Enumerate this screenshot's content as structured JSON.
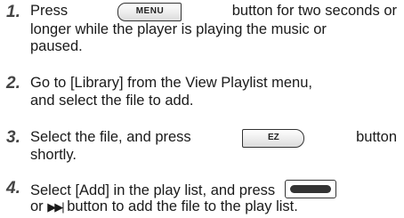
{
  "steps": [
    {
      "number": "1.",
      "line1_before": "Press",
      "button": "MENU",
      "line1_after": "button for two seconds or",
      "line2": "longer while the player is playing the music or",
      "line3": "paused."
    },
    {
      "number": "2.",
      "line1": "Go to [Library] from the View Playlist menu,",
      "line2": "and select the file to add."
    },
    {
      "number": "3.",
      "line1_before": "Select the file, and press",
      "button": "EZ",
      "line1_after": "button",
      "line2": "shortly."
    },
    {
      "number": "4.",
      "line1": "Select [Add] in the play list, and press",
      "line2_prefix": "or",
      "skip_symbol": "▶▶|",
      "line2": "button to add the file to the play list."
    }
  ]
}
